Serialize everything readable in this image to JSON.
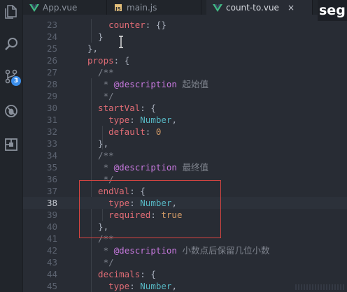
{
  "tabs": [
    {
      "label": "App.vue",
      "active": false,
      "icon": "vue-file-icon"
    },
    {
      "label": "main.js",
      "active": false,
      "icon": "js-file-icon"
    },
    {
      "label": "count-to.vue",
      "active": true,
      "icon": "vue-file-icon",
      "close": "×"
    }
  ],
  "watermark_logo": "seg",
  "activity_bar": {
    "icons": [
      "files-icon",
      "search-icon",
      "source-control-icon",
      "debug-icon",
      "extensions-icon"
    ],
    "source_control_badge": "3"
  },
  "editor": {
    "current_line": 38,
    "lines": [
      {
        "num": "23",
        "text": "    counter: {}"
      },
      {
        "num": "24",
        "text": "  }"
      },
      {
        "num": "25",
        "text": "},"
      },
      {
        "num": "26",
        "text": "props: {"
      },
      {
        "num": "27",
        "text": "  /**"
      },
      {
        "num": "28",
        "text": "   * @description 起始值"
      },
      {
        "num": "29",
        "text": "   */"
      },
      {
        "num": "30",
        "text": "  startVal: {"
      },
      {
        "num": "31",
        "text": "    type: Number,"
      },
      {
        "num": "32",
        "text": "    default: 0"
      },
      {
        "num": "33",
        "text": "  },"
      },
      {
        "num": "34",
        "text": "  /**"
      },
      {
        "num": "35",
        "text": "   * @description 最终值"
      },
      {
        "num": "36",
        "text": "   */"
      },
      {
        "num": "37",
        "text": "  endVal: {"
      },
      {
        "num": "38",
        "text": "    type: Number,"
      },
      {
        "num": "39",
        "text": "    required: true"
      },
      {
        "num": "40",
        "text": "  },"
      },
      {
        "num": "41",
        "text": "  /**"
      },
      {
        "num": "42",
        "text": "   * @description 小数点后保留几位小数"
      },
      {
        "num": "43",
        "text": "   */"
      },
      {
        "num": "44",
        "text": "  decimals: {"
      },
      {
        "num": "45",
        "text": "    type: Number,"
      }
    ]
  },
  "colors": {
    "background": "#282c34",
    "property": "#e06c75",
    "comment": "#7f848e",
    "doc_tag": "#c678dd",
    "type": "#56b6c2",
    "number": "#d19a66",
    "highlight_box": "#d64541",
    "badge": "#3b8eea"
  }
}
